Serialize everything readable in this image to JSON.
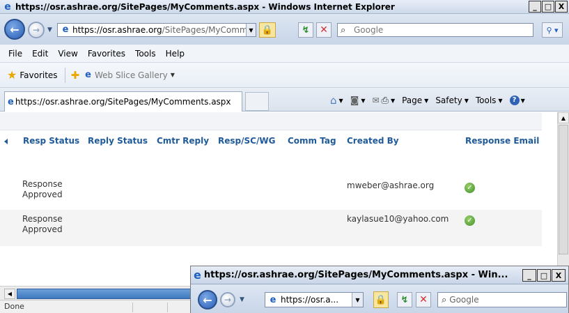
{
  "window": {
    "title": "https://osr.ashrae.org/SitePages/MyComments.aspx - Windows Internet Explorer",
    "minimize": "_",
    "maximize": "□",
    "close": "X"
  },
  "nav": {
    "back_icon": "back-arrow-icon",
    "forward_icon": "forward-arrow-icon",
    "address_host": "https://osr.ashrae.org",
    "address_path": "/SitePages/MyCommer",
    "search_placeholder": "Google"
  },
  "menu": {
    "items": [
      "File",
      "Edit",
      "View",
      "Favorites",
      "Tools",
      "Help"
    ]
  },
  "favorites": {
    "label": "Favorites",
    "web_slice": "Web Slice Gallery"
  },
  "tab": {
    "title": "https://osr.ashrae.org/SitePages/MyComments.aspx"
  },
  "commands": {
    "page": "Page",
    "safety": "Safety",
    "tools": "Tools"
  },
  "table": {
    "columns": [
      "Resp Status",
      "Reply Status",
      "Cmtr Reply",
      "Resp/SC/WG",
      "Comm Tag",
      "Created By",
      "Response Email"
    ],
    "rows": [
      {
        "resp_status": "Response Approved",
        "created_by": "mweber@ashrae.org",
        "response_email": "check"
      },
      {
        "resp_status": "Response Approved",
        "created_by": "kaylasue10@yahoo.com",
        "response_email": "check"
      }
    ]
  },
  "status": {
    "text": "Done"
  },
  "popup": {
    "title": "https://osr.ashrae.org/SitePages/MyComments.aspx - Win...",
    "address": "https://osr.a...",
    "search_placeholder": "Google"
  },
  "colors": {
    "header_link": "#1f5a9a",
    "check_green": "#3f8f2a",
    "scroll_thumb": "#3f78c0"
  }
}
